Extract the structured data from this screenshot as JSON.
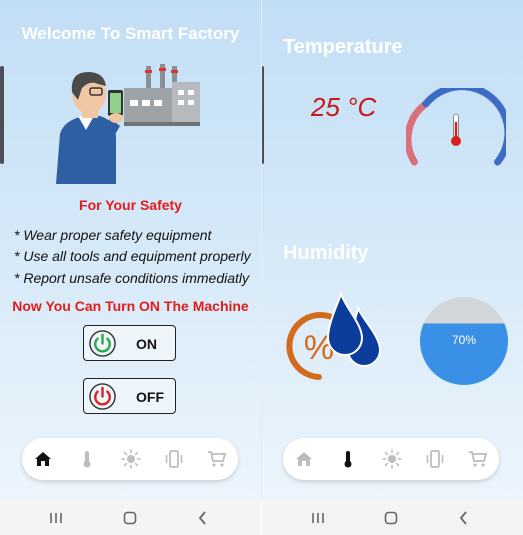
{
  "left": {
    "welcome_title": "Welcome To Smart Factory",
    "safety_title": "For Your Safety",
    "rules": [
      "* Wear proper safety equipment",
      "* Use all tools and equipment properly",
      "* Report unsafe conditions immediatly"
    ],
    "turn_on_text": "Now You Can Turn ON The Machine",
    "on_label": "ON",
    "off_label": "OFF",
    "active_tab": "home"
  },
  "right": {
    "temperature_heading": "Temperature",
    "temperature_value": "25 °C",
    "humidity_heading": "Humidity",
    "humidity_percent": "70%",
    "humidity_level": 0.7,
    "active_tab": "temperature"
  },
  "nav_items": [
    "home-icon",
    "thermometer-icon",
    "sun-icon",
    "vibration-icon",
    "cart-icon"
  ],
  "system_nav": [
    "recent-apps-icon",
    "home-button-icon",
    "back-icon"
  ],
  "colors": {
    "accent_red": "#e21b1b",
    "gauge_blue": "#3c6cc4",
    "gauge_red": "#d9707b",
    "humidity_orange": "#d46a1c",
    "humidity_blue": "#3a8fe6",
    "drop_blue": "#0c3d9c"
  }
}
